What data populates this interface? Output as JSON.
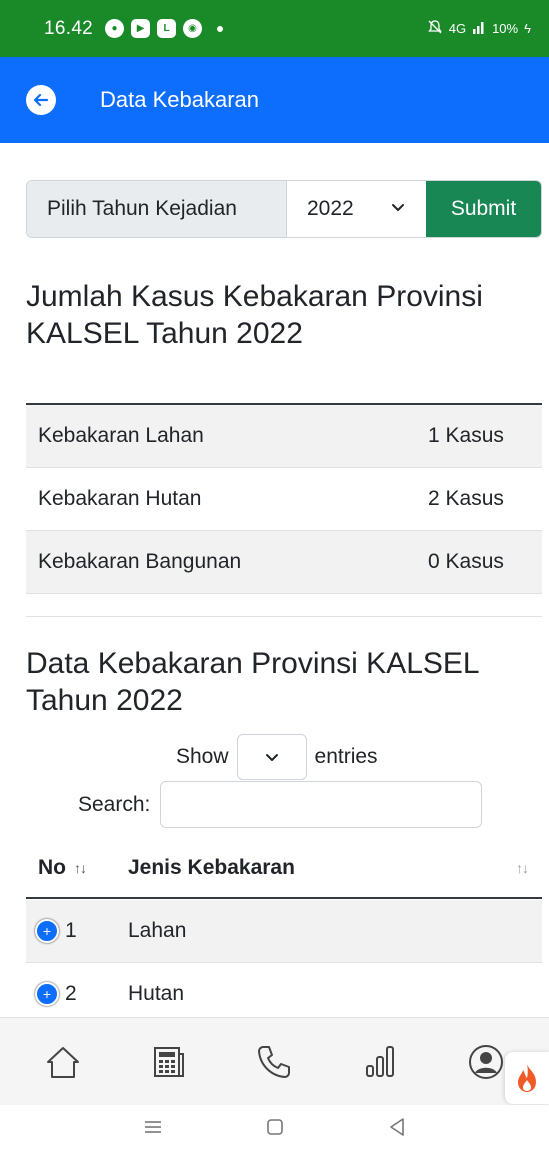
{
  "status_bar": {
    "time": "16.42",
    "signal": "4G",
    "battery": "10%"
  },
  "app_bar": {
    "title": "Data Kebakaran"
  },
  "filter": {
    "label": "Pilih Tahun Kejadian",
    "selected_year": "2022",
    "submit_label": "Submit"
  },
  "summary": {
    "title": "Jumlah Kasus Kebakaran Provinsi KALSEL Tahun 2022",
    "rows": [
      {
        "label": "Kebakaran Lahan",
        "count": "1 Kasus"
      },
      {
        "label": "Kebakaran Hutan",
        "count": "2 Kasus"
      },
      {
        "label": "Kebakaran Bangunan",
        "count": "0 Kasus"
      }
    ]
  },
  "data_table": {
    "title": "Data Kebakaran Provinsi KALSEL Tahun 2022",
    "show_label": "Show",
    "entries_label": "entries",
    "search_label": "Search:",
    "search_value": "",
    "columns": [
      "No",
      "Jenis Kebakaran"
    ],
    "rows": [
      {
        "no": "1",
        "jenis": "Lahan"
      },
      {
        "no": "2",
        "jenis": "Hutan"
      }
    ]
  },
  "bottom_nav": {
    "items": [
      "home-icon",
      "calendar-icon",
      "phone-icon",
      "chart-icon",
      "profile-icon"
    ]
  },
  "colors": {
    "status_bar": "#1a8a29",
    "app_bar": "#0d6efd",
    "submit": "#198754",
    "fire": "#f05a28"
  }
}
